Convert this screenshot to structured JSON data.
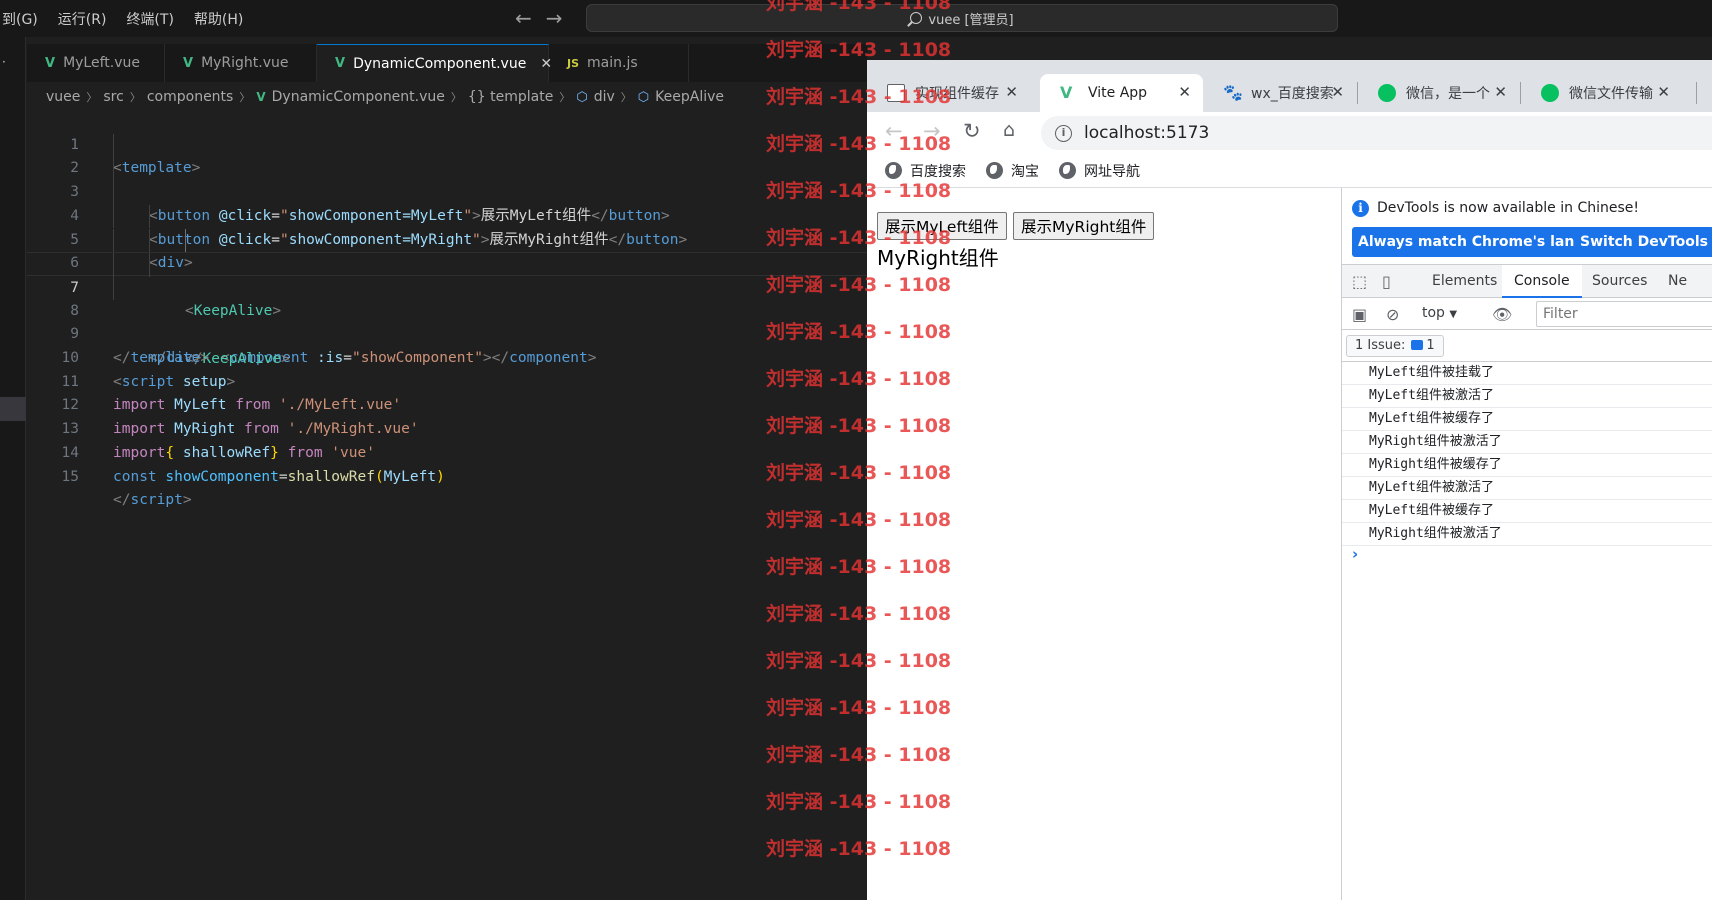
{
  "vscode": {
    "menu": [
      "到(G)",
      "运行(R)",
      "终端(T)",
      "帮助(H)"
    ],
    "command_center": "vuee [管理员]",
    "tabs": [
      {
        "label": "MyLeft.vue",
        "type": "vue",
        "active": false
      },
      {
        "label": "MyRight.vue",
        "type": "vue",
        "active": false
      },
      {
        "label": "DynamicComponent.vue",
        "type": "vue",
        "active": true
      },
      {
        "label": "main.js",
        "type": "js",
        "active": false
      }
    ],
    "breadcrumb": [
      "vuee",
      "src",
      "components",
      "DynamicComponent.vue",
      "{} template",
      "div",
      "KeepAlive"
    ],
    "current_line": 7,
    "lines": [
      {
        "n": "1"
      },
      {
        "n": "2"
      },
      {
        "n": "3"
      },
      {
        "n": "4"
      },
      {
        "n": "5"
      },
      {
        "n": "6"
      },
      {
        "n": "7"
      },
      {
        "n": "8"
      },
      {
        "n": "9"
      },
      {
        "n": "10"
      },
      {
        "n": "11"
      },
      {
        "n": "12"
      },
      {
        "n": "13"
      },
      {
        "n": "14"
      },
      {
        "n": "15"
      }
    ],
    "code": {
      "template_tag": "template",
      "button_tag": "button",
      "click_attr": "@click",
      "show_left_expr": "showComponent=MyLeft",
      "show_right_expr": "showComponent=MyRight",
      "show_left_text": "展示MyLeft组件",
      "show_right_text": "展示MyRight组件",
      "div_tag": "div",
      "keepalive_tag": "KeepAlive",
      "component_tag": "component",
      "is_attr": ":is",
      "is_value": "showComponent",
      "script_tag": "script",
      "setup_attr": "setup",
      "kw_import": "import",
      "kw_from": "from",
      "kw_const": "const",
      "id_myleft": "MyLeft",
      "id_myright": "MyRight",
      "id_shallowref": "shallowRef",
      "id_showcomponent": "showComponent",
      "str_myleft": "'./MyLeft.vue'",
      "str_myright": "'./MyRight.vue'",
      "str_vue": "'vue'"
    }
  },
  "browser": {
    "tabs": [
      {
        "title": "实现组件缓存",
        "icon": "page-icon",
        "active": false
      },
      {
        "title": "Vite App",
        "icon": "vite-icon",
        "active": true
      },
      {
        "title": "wx_百度搜索",
        "icon": "baidu-icon",
        "active": false
      },
      {
        "title": "微信，是一个",
        "icon": "wechat-icon",
        "active": false
      },
      {
        "title": "微信文件传输",
        "icon": "wechat-icon",
        "active": false
      }
    ],
    "url": "localhost:5173",
    "bookmarks": [
      "百度搜索",
      "淘宝",
      "网址导航"
    ],
    "page": {
      "buttons": [
        "展示MyLeft组件",
        "展示MyRight组件"
      ],
      "content": "MyRight组件"
    },
    "devtools": {
      "banner": "DevTools is now available in Chinese!",
      "banner_buttons": [
        "Always match Chrome's language",
        "Switch DevTools"
      ],
      "tabs": [
        "Elements",
        "Console",
        "Sources",
        "Ne"
      ],
      "active_tab": "Console",
      "context": "top",
      "filter_placeholder": "Filter",
      "issues_label": "1 Issue:",
      "issues_count": "1",
      "logs": [
        "MyLeft组件被挂载了",
        "MyLeft组件被激活了",
        "MyLeft组件被缓存了",
        "MyRight组件被激活了",
        "MyRight组件被缓存了",
        "MyLeft组件被激活了",
        "MyLeft组件被缓存了",
        "MyRight组件被激活了"
      ],
      "prompt": "›"
    }
  },
  "watermark": {
    "text": "刘宇涵 -143 - 1108",
    "color": "#e43232"
  }
}
